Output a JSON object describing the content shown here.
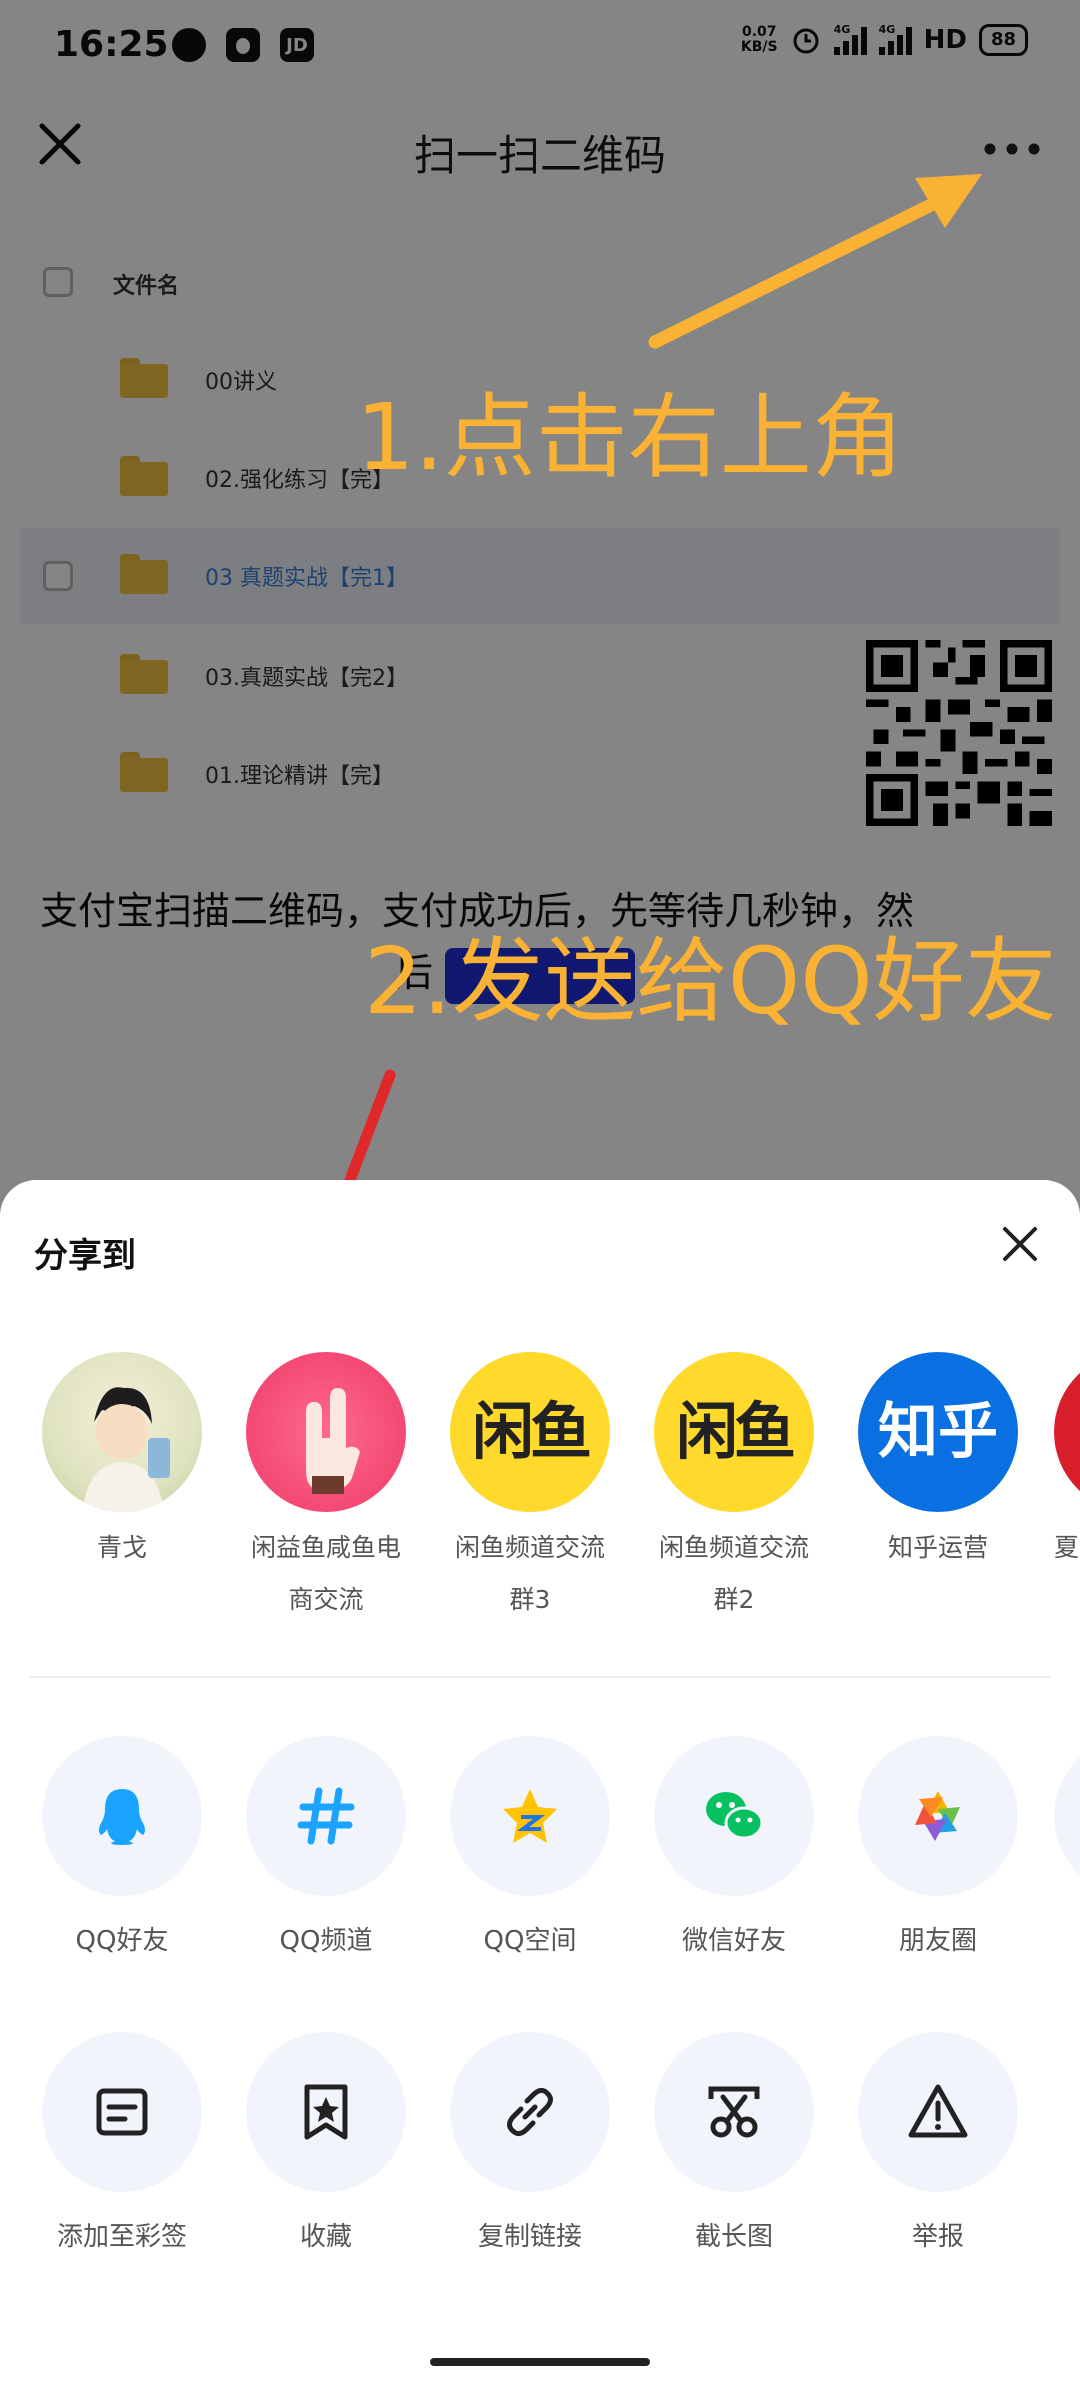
{
  "status_bar": {
    "time": "16:25",
    "left_icons": [
      "chat-bubble-icon",
      "qq-icon",
      "jd-icon"
    ],
    "jd_label": "JD",
    "speed_value": "0.07",
    "speed_unit": "KB/S",
    "network_tag": "4G",
    "hd_label": "HD",
    "battery": "88"
  },
  "header": {
    "title": "扫一扫二维码",
    "close_icon": "close-icon",
    "more_icon": "more-dots-icon"
  },
  "file_list": {
    "header_label": "文件名",
    "rows": [
      {
        "name": "00讲义",
        "highlight": false
      },
      {
        "name": "02.强化练习【完】",
        "highlight": false
      },
      {
        "name": "03 真题实战【完1】",
        "highlight": true
      },
      {
        "name": "03.真题实战【完2】",
        "highlight": false
      },
      {
        "name": "01.理论精讲【完】",
        "highlight": false
      }
    ]
  },
  "pay_text": {
    "line1": "支付宝扫描二维码，支付成功后，先等待几秒钟，然",
    "line2": "后"
  },
  "annotations": {
    "note1": "1.点击右上角",
    "note2": "2.发送给QQ好友",
    "color": "#f9b233",
    "arrow2_color": "#e0282b"
  },
  "share_sheet": {
    "title": "分享到",
    "contacts": [
      {
        "label_line1": "青戈",
        "label_line2": "",
        "avatar": "user-avatar",
        "avatar_text": ""
      },
      {
        "label_line1": "闲益鱼咸鱼电",
        "label_line2": "商交流",
        "avatar": "hand-avatar",
        "avatar_text": ""
      },
      {
        "label_line1": "闲鱼频道交流",
        "label_line2": "群3",
        "avatar": "xianyu-avatar",
        "avatar_text": "闲鱼"
      },
      {
        "label_line1": "闲鱼频道交流",
        "label_line2": "群2",
        "avatar": "xianyu-avatar",
        "avatar_text": "闲鱼"
      },
      {
        "label_line1": "知乎运营",
        "label_line2": "",
        "avatar": "zhihu-avatar",
        "avatar_text": "知乎"
      },
      {
        "label_line1": "夏",
        "label_line2": "",
        "avatar": "red-avatar",
        "avatar_text": ""
      }
    ],
    "share_targets": [
      {
        "label": "QQ好友",
        "icon": "qq-penguin-icon"
      },
      {
        "label": "QQ频道",
        "icon": "hashtag-icon"
      },
      {
        "label": "QQ空间",
        "icon": "qzone-star-icon"
      },
      {
        "label": "微信好友",
        "icon": "wechat-icon"
      },
      {
        "label": "朋友圈",
        "icon": "moments-aperture-icon"
      }
    ],
    "actions": [
      {
        "label": "添加至彩签",
        "icon": "note-icon"
      },
      {
        "label": "收藏",
        "icon": "bookmark-star-icon"
      },
      {
        "label": "复制链接",
        "icon": "link-icon"
      },
      {
        "label": "截长图",
        "icon": "scissors-icon"
      },
      {
        "label": "举报",
        "icon": "warning-icon"
      }
    ]
  }
}
